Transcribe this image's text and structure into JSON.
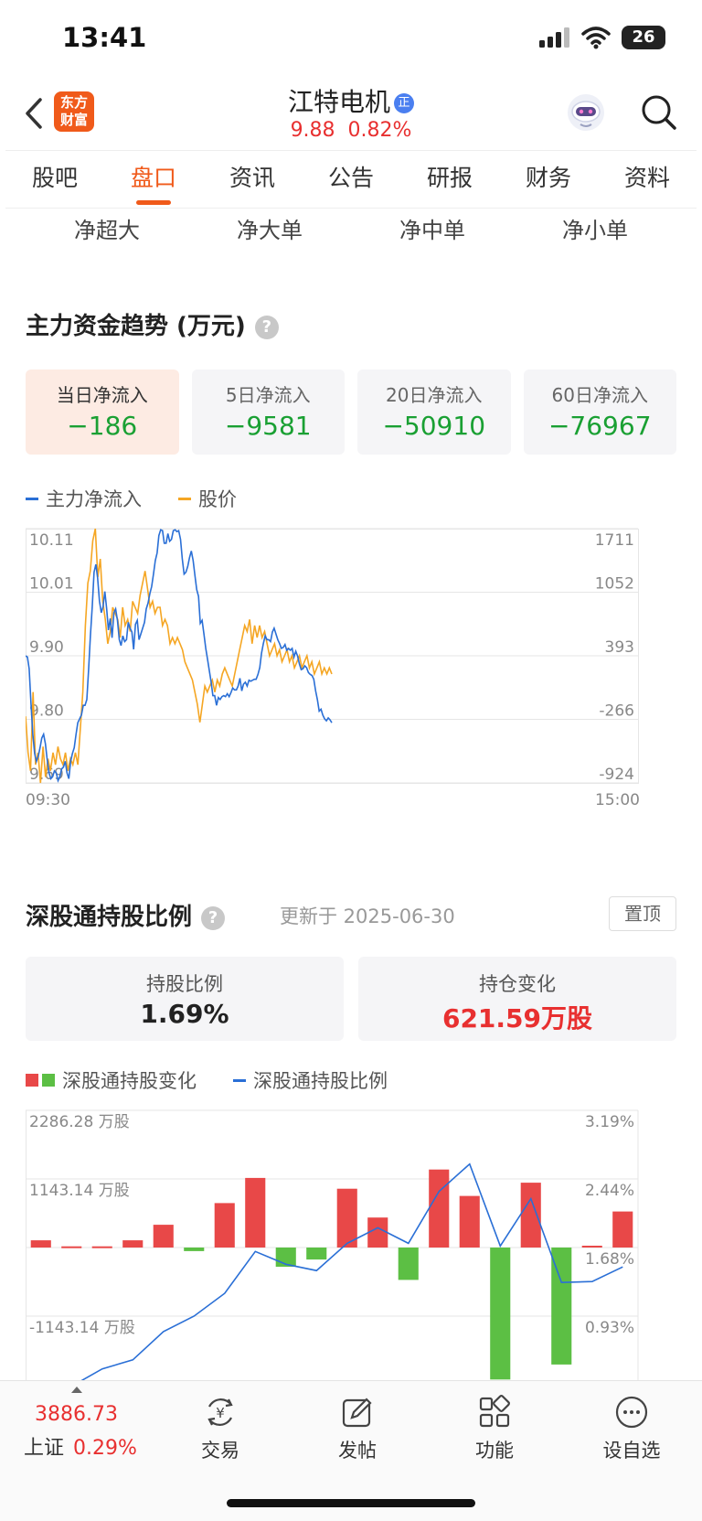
{
  "status_bar": {
    "time": "13:41",
    "battery": "26"
  },
  "header": {
    "logo_line1": "东方",
    "logo_line2": "财富",
    "stock_name": "江特电机",
    "badge": "正",
    "price": "9.88",
    "change_pct": "0.82%"
  },
  "tabs": [
    "股吧",
    "盘口",
    "资讯",
    "公告",
    "研报",
    "财务",
    "资料"
  ],
  "subcats": [
    "净超大",
    "净大单",
    "净中单",
    "净小单"
  ],
  "fund_section": {
    "title": "主力资金趋势 (万元)",
    "help": "?",
    "cards": [
      {
        "label": "当日净流入",
        "value": "−186"
      },
      {
        "label": "5日净流入",
        "value": "−9581"
      },
      {
        "label": "20日净流入",
        "value": "−50910"
      },
      {
        "label": "60日净流入",
        "value": "−76967"
      }
    ],
    "legend": [
      "主力净流入",
      "股价"
    ]
  },
  "colors": {
    "accent": "#f05a1a",
    "up_red": "#e83030",
    "down_green": "#1aa033",
    "line_blue": "#2a6fd6",
    "line_orange": "#f5a623",
    "bar_red": "#e84848",
    "bar_green": "#5cbf44"
  },
  "chart_data": [
    {
      "type": "line",
      "x_start": "09:30",
      "x_end": "15:00",
      "left_ticks": [
        "10.11",
        "10.01",
        "9.90",
        "9.80",
        "9.69"
      ],
      "right_ticks": [
        "1711",
        "1052",
        "393",
        "-266",
        "-924"
      ],
      "series": [
        {
          "name": "主力净流入",
          "color": "#2a6fd6",
          "values": [
            393,
            380,
            260,
            -100,
            -420,
            -620,
            -700,
            -650,
            -560,
            -460,
            -420,
            -520,
            -680,
            -820,
            -880,
            -860,
            -800,
            -820,
            -900,
            -860,
            -780,
            -760,
            -700,
            -820,
            -880,
            -700,
            -620,
            -560,
            -420,
            -300,
            -260,
            -220,
            -120,
            -120,
            -60,
            260,
            600,
            900,
            1260,
            1340,
            1200,
            960,
            840,
            900,
            1060,
            880,
            660,
            780,
            580,
            840,
            880,
            760,
            560,
            500,
            600,
            540,
            560,
            740,
            680,
            640,
            460,
            720,
            760,
            560,
            620,
            680,
            740,
            880,
            940,
            1040,
            1110,
            1240,
            1380,
            1460,
            1640,
            1700,
            1690,
            1560,
            1560,
            1660,
            1580,
            1600,
            1690,
            1700,
            1680,
            1690,
            1600,
            1400,
            1240,
            1260,
            1320,
            1410,
            1480,
            1380,
            1230,
            1080,
            1010,
            730,
            760,
            620,
            470,
            360,
            240,
            120,
            -20,
            -20,
            -120,
            -40,
            -60,
            -30,
            -20,
            -30,
            0,
            -30,
            10,
            60,
            40,
            40,
            80,
            160,
            30,
            100,
            120,
            80,
            140,
            130,
            140,
            150,
            150,
            200,
            270,
            420,
            520,
            600,
            560,
            560,
            540,
            640,
            680,
            620,
            560,
            520,
            470,
            480,
            510,
            450,
            470,
            450,
            470,
            380,
            440,
            390,
            310,
            250,
            260,
            290,
            270,
            220,
            200,
            190,
            150,
            30,
            -60,
            -180,
            -160,
            -220,
            -260,
            -280,
            -250,
            -270,
            -300
          ]
        },
        {
          "name": "股价",
          "color": "#f5a623",
          "values": [
            9.8,
            9.74,
            9.71,
            9.84,
            9.72,
            9.74,
            9.69,
            9.75,
            9.7,
            9.73,
            9.71,
            9.74,
            9.72,
            9.75,
            9.73,
            9.72,
            9.74,
            9.71,
            9.73,
            9.72,
            9.74,
            9.72,
            9.78,
            9.84,
            9.95,
            10.02,
            10.04,
            10.09,
            10.11,
            10.03,
            10.06,
            9.99,
            9.96,
            9.92,
            9.94,
            9.98,
            9.97,
            9.96,
            9.93,
            9.98,
            9.95,
            9.96,
            9.94,
            9.99,
            9.98,
            9.97,
            10.0,
            10.02,
            10.04,
            10.01,
            9.98,
            9.99,
            9.97,
            9.98,
            9.98,
            9.95,
            9.96,
            9.95,
            9.92,
            9.93,
            9.92,
            9.93,
            9.92,
            9.91,
            9.89,
            9.88,
            9.87,
            9.86,
            9.84,
            9.82,
            9.79,
            9.82,
            9.85,
            9.84,
            9.85,
            9.86,
            9.84,
            9.86,
            9.85,
            9.87,
            9.88,
            9.87,
            9.86,
            9.85,
            9.87,
            9.89,
            9.91,
            9.93,
            9.95,
            9.94,
            9.96,
            9.92,
            9.95,
            9.93,
            9.95,
            9.93,
            9.94,
            9.92,
            9.9,
            9.91,
            9.92,
            9.9,
            9.91,
            9.89,
            9.9,
            9.91,
            9.89,
            9.9,
            9.88,
            9.89,
            9.9,
            9.88,
            9.89,
            9.9,
            9.88,
            9.89,
            9.87,
            9.88,
            9.89,
            9.87,
            9.88,
            9.87,
            9.88,
            9.87
          ]
        }
      ]
    },
    {
      "type": "bar",
      "left_ticks": [
        "2286.28 万股",
        "1143.14 万股",
        "",
        "-1143.14 万股"
      ],
      "right_ticks": [
        "3.19%",
        "2.44%",
        "1.68%",
        "0.93%"
      ],
      "series": [
        {
          "name": "深股通持股变化",
          "unit": "万股",
          "values": [
            120,
            20,
            20,
            120,
            380,
            -60,
            740,
            1160,
            -320,
            -200,
            980,
            500,
            -540,
            1300,
            860,
            -2200,
            1080,
            -1950,
            30,
            600
          ]
        },
        {
          "name": "深股通持股比例",
          "unit": "%",
          "values": [
            0.16,
            0.16,
            0.35,
            0.45,
            0.76,
            0.93,
            1.18,
            1.64,
            1.5,
            1.43,
            1.73,
            1.9,
            1.73,
            2.3,
            2.6,
            1.7,
            2.22,
            1.3,
            1.31,
            1.47
          ]
        }
      ]
    }
  ],
  "hk_section": {
    "title": "深股通持股比例",
    "help": "?",
    "update": "更新于 2025-06-30",
    "pin": "置顶",
    "ratio_label": "持股比例",
    "ratio_value": "1.69%",
    "change_label": "持仓变化",
    "change_value": "621.59万股",
    "legend_bar": "深股通持股变化",
    "legend_line": "深股通持股比例"
  },
  "bottom_bar": {
    "index_value": "3886.73",
    "index_name": "上证",
    "index_pct": "0.29%",
    "buttons": [
      {
        "label": "交易",
        "icon": "yen-exchange-icon"
      },
      {
        "label": "发帖",
        "icon": "edit-icon"
      },
      {
        "label": "功能",
        "icon": "grid-icon"
      },
      {
        "label": "设自选",
        "icon": "more-icon"
      }
    ]
  }
}
